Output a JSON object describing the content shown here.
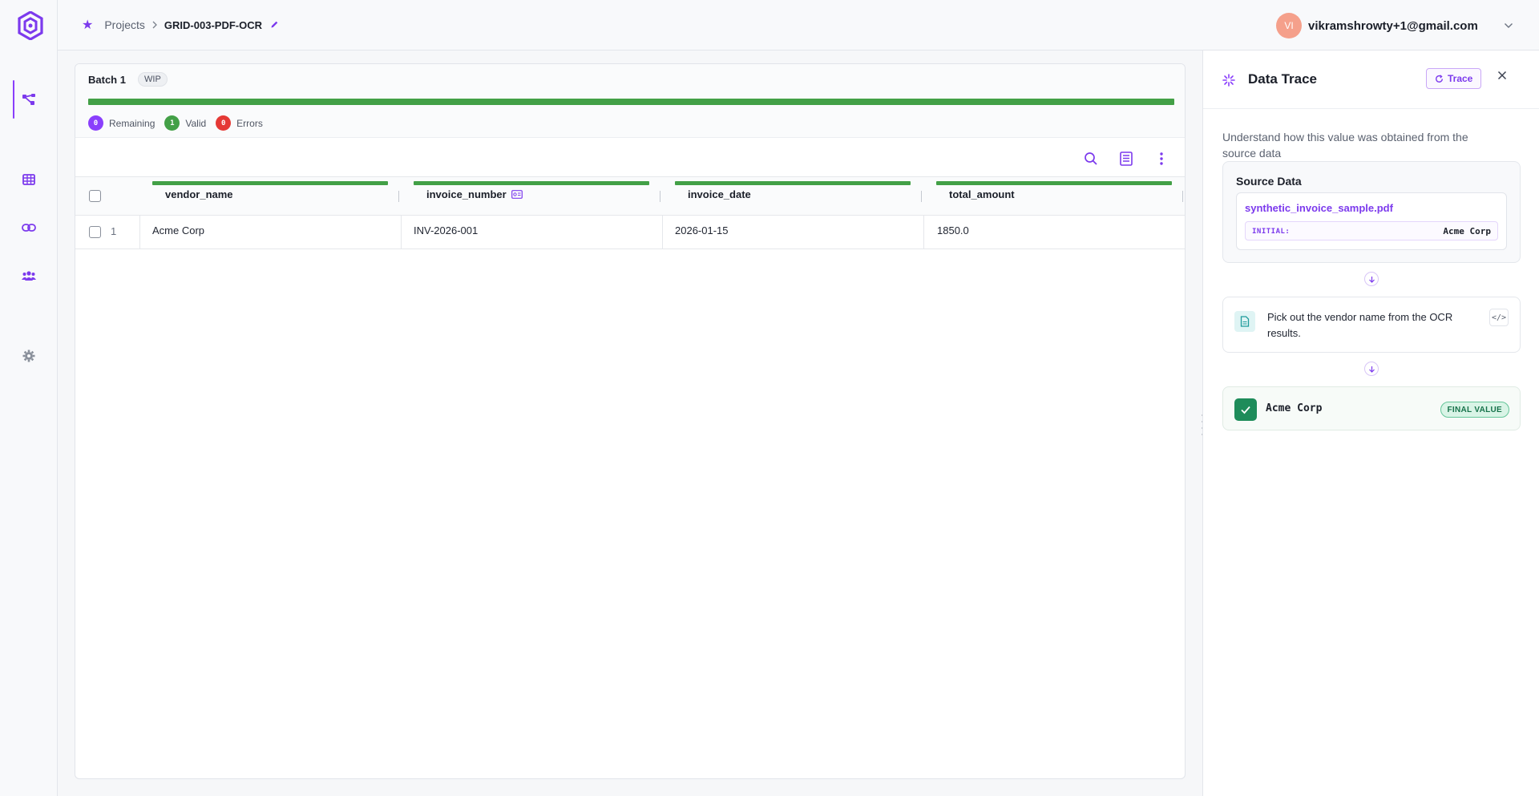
{
  "breadcrumb": {
    "projects": "Projects",
    "current": "GRID-003-PDF-OCR"
  },
  "user": {
    "initials": "VI",
    "email": "vikramshrowty+1@gmail.com"
  },
  "batch": {
    "title": "Batch 1",
    "status": "WIP",
    "progress_fraction": 1.0,
    "stats": [
      {
        "count": "0",
        "label": "Remaining",
        "color": "#8a3ffc"
      },
      {
        "count": "1",
        "label": "Valid",
        "color": "#43a047"
      },
      {
        "count": "0",
        "label": "Errors",
        "color": "#e53935"
      }
    ]
  },
  "grid": {
    "columns": [
      "vendor_name",
      "invoice_number",
      "invoice_date",
      "total_amount"
    ],
    "rows": [
      {
        "num": "1",
        "cells": [
          "Acme Corp",
          "INV-2026-001",
          "2026-01-15",
          "1850.0"
        ]
      }
    ]
  },
  "panel": {
    "title": "Data Trace",
    "trace_label": "Trace",
    "description": "Understand how this value was obtained from the source data",
    "source_label": "Source Data",
    "source_file": "synthetic_invoice_sample.pdf",
    "initial_label": "INITIAL:",
    "initial_value": "Acme Corp",
    "step_text": "Pick out the vendor name from the OCR results.",
    "code_label": "</>",
    "final_value": "Acme Corp",
    "final_badge": "FINAL VALUE"
  },
  "colors": {
    "accent": "#8a3ffc",
    "success": "#43a047",
    "error": "#e53935"
  }
}
